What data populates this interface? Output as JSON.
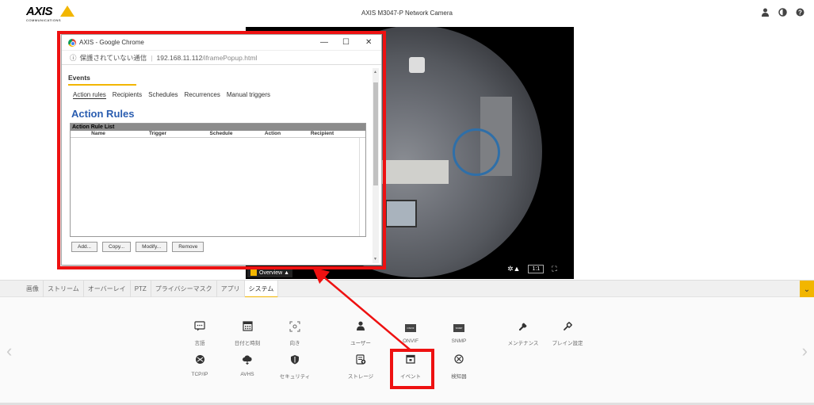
{
  "header": {
    "logo_text": "AXIS",
    "logo_sub": "COMMUNICATIONS",
    "camera_title": "AXIS M3047-P Network Camera",
    "icons": [
      "user-icon",
      "contrast-icon",
      "help-icon"
    ]
  },
  "popup": {
    "window_title": "AXIS - Google Chrome",
    "url_security": "保護されていない通信",
    "url_host": "192.168.11.112",
    "url_path": "/iframePopup.html",
    "section": "Events",
    "subtabs": [
      "Action rules",
      "Recipients",
      "Schedules",
      "Recurrences",
      "Manual triggers"
    ],
    "page_title": "Action Rules",
    "list_title": "Action Rule List",
    "columns": [
      "Name",
      "Trigger",
      "Schedule",
      "Action",
      "Recipient"
    ],
    "buttons": [
      "Add...",
      "Copy...",
      "Modify...",
      "Remove"
    ]
  },
  "video": {
    "overview_label": "Overview",
    "ratio_label": "1:1"
  },
  "tabs": [
    "画像",
    "ストリーム",
    "オーバーレイ",
    "PTZ",
    "プライバシーマスク",
    "アプリ",
    "システム"
  ],
  "active_tab": "システム",
  "system_items": {
    "row1": [
      {
        "label": "言語",
        "icon": "language-icon"
      },
      {
        "label": "日付と時刻",
        "icon": "calendar-icon"
      },
      {
        "label": "向き",
        "icon": "orientation-icon"
      },
      {
        "label": "ユーザー",
        "icon": "user-icon"
      },
      {
        "label": "ONVIF",
        "icon": "onvif-icon",
        "badge": "ONVIF"
      },
      {
        "label": "SNMP",
        "icon": "snmp-icon",
        "badge": "SNMP"
      },
      {
        "label": "メンテナンス",
        "icon": "wrench-icon"
      },
      {
        "label": "プレイン設定",
        "icon": "plain-config-icon"
      }
    ],
    "row2": [
      {
        "label": "TCP/IP",
        "icon": "network-icon"
      },
      {
        "label": "AVHS",
        "icon": "cloud-icon"
      },
      {
        "label": "セキュリティ",
        "icon": "shield-icon"
      },
      {
        "label": "ストレージ",
        "icon": "storage-icon"
      },
      {
        "label": "イベント",
        "icon": "event-icon"
      },
      {
        "label": "検知器",
        "icon": "detector-icon"
      }
    ]
  },
  "colors": {
    "accent": "#f2b600",
    "highlight": "#ee1111",
    "title_blue": "#2a5db0"
  }
}
